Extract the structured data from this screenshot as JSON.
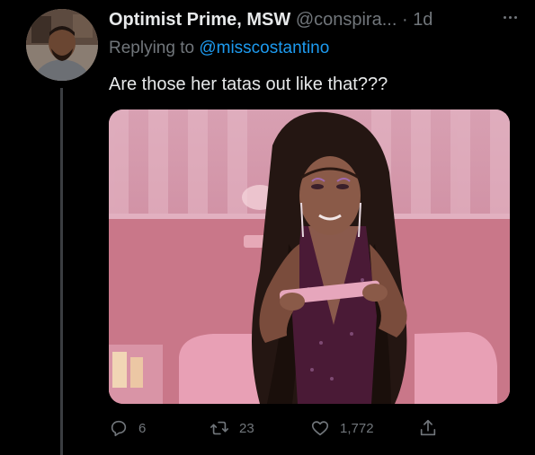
{
  "tweet": {
    "display_name": "Optimist Prime, MSW",
    "handle": "@conspira...",
    "separator": "·",
    "time": "1d",
    "replying_prefix": "Replying to",
    "replying_to": "@misscostantino",
    "text": "Are those her tatas out like that???"
  },
  "actions": {
    "replies": "6",
    "retweets": "23",
    "likes": "1,772"
  },
  "colors": {
    "background": "#000000",
    "text": "#e7e9ea",
    "secondary": "#71767b",
    "link": "#1d9bf0",
    "thread_line": "#3a3d41"
  },
  "icons": [
    "more-icon",
    "reply-icon",
    "retweet-icon",
    "like-icon",
    "share-icon"
  ]
}
